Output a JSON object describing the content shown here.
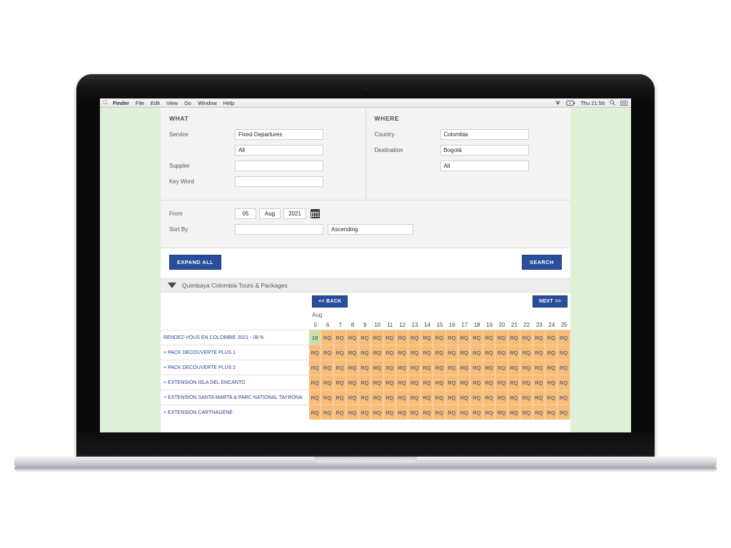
{
  "menubar": {
    "apple_icon": "apple-icon",
    "items": [
      {
        "label": "Finder",
        "bold": true
      },
      {
        "label": "File",
        "bold": false
      },
      {
        "label": "Edit",
        "bold": false
      },
      {
        "label": "View",
        "bold": false
      },
      {
        "label": "Go",
        "bold": false
      },
      {
        "label": "Window",
        "bold": false
      },
      {
        "label": "Help",
        "bold": false
      }
    ],
    "status": {
      "wifi_icon": "wifi-icon",
      "battery_icon": "battery-icon",
      "clock": "Thu 21:56",
      "search_icon": "search-icon",
      "list_icon": "list-icon"
    }
  },
  "colors": {
    "accent_blue": "#2a4d9b",
    "page_green": "#dff0d8",
    "cell_orange": "#f7bd76",
    "cell_green": "#c7e0ac",
    "link_blue": "#2b3f8f"
  },
  "search_form": {
    "what": {
      "title": "WHAT",
      "fields": [
        {
          "label": "Service",
          "value": "Fixed Departures"
        },
        {
          "label": "",
          "value": "All"
        },
        {
          "label": "Supplier",
          "value": ""
        },
        {
          "label": "Key Word",
          "value": ""
        }
      ]
    },
    "where": {
      "title": "WHERE",
      "fields": [
        {
          "label": "Country",
          "value": "Colombia"
        },
        {
          "label": "Destination",
          "value": "Bogotá"
        },
        {
          "label": "",
          "value": "All"
        }
      ]
    },
    "from": {
      "label": "From",
      "day": "05",
      "month": "Aug",
      "year": "2021",
      "calendar_icon": "calendar-icon"
    },
    "sort_by": {
      "label": "Sort By",
      "field_value": "",
      "direction": "Ascending"
    }
  },
  "buttons": {
    "expand_all": "EXPAND ALL",
    "search": "SEARCH"
  },
  "results": {
    "group_title": "Quimbaya Colombia Tours & Packages",
    "collapse_icon": "chevron-down-icon",
    "nav": {
      "back": "<< BACK",
      "next": "NEXT >>"
    },
    "calendar": {
      "month": "Aug",
      "days": [
        "5",
        "6",
        "7",
        "8",
        "9",
        "10",
        "11",
        "12",
        "13",
        "14",
        "15",
        "16",
        "17",
        "18",
        "19",
        "20",
        "21",
        "22",
        "23",
        "24",
        "25"
      ]
    },
    "rows": [
      {
        "label": "RENDEZ-VOUS EN COLOMBIE 2021 - 08 N",
        "cells": [
          {
            "text": "18",
            "status": "available"
          },
          {
            "text": "RQ",
            "status": "request"
          },
          {
            "text": "RQ",
            "status": "request"
          },
          {
            "text": "RQ",
            "status": "request"
          },
          {
            "text": "RQ",
            "status": "request"
          },
          {
            "text": "RQ",
            "status": "request"
          },
          {
            "text": "RQ",
            "status": "request"
          },
          {
            "text": "RQ",
            "status": "request"
          },
          {
            "text": "RQ",
            "status": "request"
          },
          {
            "text": "RQ",
            "status": "request"
          },
          {
            "text": "RQ",
            "status": "request"
          },
          {
            "text": "RQ",
            "status": "request"
          },
          {
            "text": "RQ",
            "status": "request"
          },
          {
            "text": "RQ",
            "status": "request"
          },
          {
            "text": "RQ",
            "status": "request"
          },
          {
            "text": "RQ",
            "status": "request"
          },
          {
            "text": "RQ",
            "status": "request"
          },
          {
            "text": "RQ",
            "status": "request"
          },
          {
            "text": "RQ",
            "status": "request"
          },
          {
            "text": "RQ",
            "status": "request"
          },
          {
            "text": "RQ",
            "status": "request"
          }
        ]
      },
      {
        "label": "+ PACK DECOUVERTE PLUS 1",
        "cells": [
          {
            "text": "RQ",
            "status": "request"
          },
          {
            "text": "RQ",
            "status": "request"
          },
          {
            "text": "RQ",
            "status": "request"
          },
          {
            "text": "RQ",
            "status": "request"
          },
          {
            "text": "RQ",
            "status": "request"
          },
          {
            "text": "RQ",
            "status": "request"
          },
          {
            "text": "RQ",
            "status": "request"
          },
          {
            "text": "RQ",
            "status": "request"
          },
          {
            "text": "RQ",
            "status": "request"
          },
          {
            "text": "RQ",
            "status": "request"
          },
          {
            "text": "RQ",
            "status": "request"
          },
          {
            "text": "RQ",
            "status": "request"
          },
          {
            "text": "RQ",
            "status": "request"
          },
          {
            "text": "RQ",
            "status": "request"
          },
          {
            "text": "RQ",
            "status": "request"
          },
          {
            "text": "RQ",
            "status": "request"
          },
          {
            "text": "RQ",
            "status": "request"
          },
          {
            "text": "RQ",
            "status": "request"
          },
          {
            "text": "RQ",
            "status": "request"
          },
          {
            "text": "RQ",
            "status": "request"
          },
          {
            "text": "RQ",
            "status": "request"
          }
        ]
      },
      {
        "label": "+ PACK DECOUVERTE PLUS 2",
        "cells": [
          {
            "text": "RQ",
            "status": "request"
          },
          {
            "text": "RQ",
            "status": "request"
          },
          {
            "text": "RQ",
            "status": "request"
          },
          {
            "text": "RQ",
            "status": "request"
          },
          {
            "text": "RQ",
            "status": "request"
          },
          {
            "text": "RQ",
            "status": "request"
          },
          {
            "text": "RQ",
            "status": "request"
          },
          {
            "text": "RQ",
            "status": "request"
          },
          {
            "text": "RQ",
            "status": "request"
          },
          {
            "text": "RQ",
            "status": "request"
          },
          {
            "text": "RQ",
            "status": "request"
          },
          {
            "text": "RQ",
            "status": "request"
          },
          {
            "text": "RQ",
            "status": "request"
          },
          {
            "text": "RQ",
            "status": "request"
          },
          {
            "text": "RQ",
            "status": "request"
          },
          {
            "text": "RQ",
            "status": "request"
          },
          {
            "text": "RQ",
            "status": "request"
          },
          {
            "text": "RQ",
            "status": "request"
          },
          {
            "text": "RQ",
            "status": "request"
          },
          {
            "text": "RQ",
            "status": "request"
          },
          {
            "text": "RQ",
            "status": "request"
          }
        ]
      },
      {
        "label": "+ EXTENSION ISLA DEL ENCANTO",
        "cells": [
          {
            "text": "RQ",
            "status": "request"
          },
          {
            "text": "RQ",
            "status": "request"
          },
          {
            "text": "RQ",
            "status": "request"
          },
          {
            "text": "RQ",
            "status": "request"
          },
          {
            "text": "RQ",
            "status": "request"
          },
          {
            "text": "RQ",
            "status": "request"
          },
          {
            "text": "RQ",
            "status": "request"
          },
          {
            "text": "RQ",
            "status": "request"
          },
          {
            "text": "RQ",
            "status": "request"
          },
          {
            "text": "RQ",
            "status": "request"
          },
          {
            "text": "RQ",
            "status": "request"
          },
          {
            "text": "RQ",
            "status": "request"
          },
          {
            "text": "RQ",
            "status": "request"
          },
          {
            "text": "RQ",
            "status": "request"
          },
          {
            "text": "RQ",
            "status": "request"
          },
          {
            "text": "RQ",
            "status": "request"
          },
          {
            "text": "RQ",
            "status": "request"
          },
          {
            "text": "RQ",
            "status": "request"
          },
          {
            "text": "RQ",
            "status": "request"
          },
          {
            "text": "RQ",
            "status": "request"
          },
          {
            "text": "RQ",
            "status": "request"
          }
        ]
      },
      {
        "label": "+ EXTENSION SANTA MARTA & PARC NATIONAL TAYRONA",
        "cells": [
          {
            "text": "RQ",
            "status": "request"
          },
          {
            "text": "RQ",
            "status": "request"
          },
          {
            "text": "RQ",
            "status": "request"
          },
          {
            "text": "RQ",
            "status": "request"
          },
          {
            "text": "RQ",
            "status": "request"
          },
          {
            "text": "RQ",
            "status": "request"
          },
          {
            "text": "RQ",
            "status": "request"
          },
          {
            "text": "RQ",
            "status": "request"
          },
          {
            "text": "RQ",
            "status": "request"
          },
          {
            "text": "RQ",
            "status": "request"
          },
          {
            "text": "RQ",
            "status": "request"
          },
          {
            "text": "RQ",
            "status": "request"
          },
          {
            "text": "RQ",
            "status": "request"
          },
          {
            "text": "RQ",
            "status": "request"
          },
          {
            "text": "RQ",
            "status": "request"
          },
          {
            "text": "RQ",
            "status": "request"
          },
          {
            "text": "RQ",
            "status": "request"
          },
          {
            "text": "RQ",
            "status": "request"
          },
          {
            "text": "RQ",
            "status": "request"
          },
          {
            "text": "RQ",
            "status": "request"
          },
          {
            "text": "RQ",
            "status": "request"
          }
        ]
      },
      {
        "label": "+ EXTENSION CARTHAGENE",
        "cells": [
          {
            "text": "RQ",
            "status": "request"
          },
          {
            "text": "RQ",
            "status": "request"
          },
          {
            "text": "RQ",
            "status": "request"
          },
          {
            "text": "RQ",
            "status": "request"
          },
          {
            "text": "RQ",
            "status": "request"
          },
          {
            "text": "RQ",
            "status": "request"
          },
          {
            "text": "RQ",
            "status": "request"
          },
          {
            "text": "RQ",
            "status": "request"
          },
          {
            "text": "RQ",
            "status": "request"
          },
          {
            "text": "RQ",
            "status": "request"
          },
          {
            "text": "RQ",
            "status": "request"
          },
          {
            "text": "RQ",
            "status": "request"
          },
          {
            "text": "RQ",
            "status": "request"
          },
          {
            "text": "RQ",
            "status": "request"
          },
          {
            "text": "RQ",
            "status": "request"
          },
          {
            "text": "RQ",
            "status": "request"
          },
          {
            "text": "RQ",
            "status": "request"
          },
          {
            "text": "RQ",
            "status": "request"
          },
          {
            "text": "RQ",
            "status": "request"
          },
          {
            "text": "RQ",
            "status": "request"
          },
          {
            "text": "RQ",
            "status": "request"
          }
        ]
      }
    ]
  }
}
